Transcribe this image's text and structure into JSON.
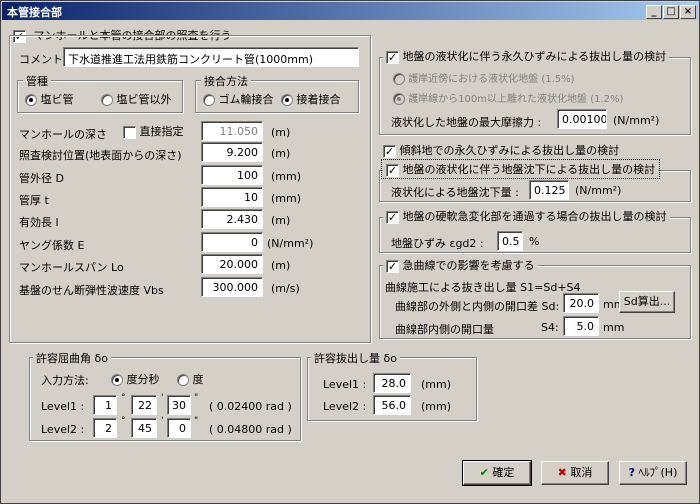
{
  "window": {
    "title": "本管接合部"
  },
  "main_check": {
    "label": "マンホールと本管の接合部の照査を行う",
    "checked": true
  },
  "comment": {
    "label": "コメント:",
    "value": "下水道推進工法用鉄筋コンクリート管(1000mm)"
  },
  "pipe_type": {
    "title": "管種",
    "options": [
      "塩ビ管",
      "塩ビ管以外"
    ],
    "selected": 0
  },
  "joint_method": {
    "title": "接合方法",
    "options": [
      "ゴム輪接合",
      "接着接合"
    ],
    "selected": 1
  },
  "fields": {
    "manhole_depth": {
      "label": "マンホールの深さ",
      "direct_label": "直接指定",
      "value": "11.050",
      "unit": "(m)"
    },
    "check_position": {
      "label": "照査検討位置(地表面からの深さ)",
      "value": "9.200",
      "unit": "(m)"
    },
    "outer_diameter": {
      "label": "管外径 D",
      "value": "100",
      "unit": "(mm)"
    },
    "thickness": {
      "label": "管厚 t",
      "value": "10",
      "unit": "(mm)"
    },
    "effective_length": {
      "label": "有効長 l",
      "value": "2.430",
      "unit": "(m)"
    },
    "young_modulus": {
      "label": "ヤング係数 E",
      "value": "0",
      "unit": "(N/mm²)"
    },
    "manhole_span": {
      "label": "マンホールスパン Lo",
      "value": "20.000",
      "unit": "(m)"
    },
    "shear_wave": {
      "label": "基盤のせん断弾性波速度 Vbs",
      "value": "300.000",
      "unit": "(m/s)"
    }
  },
  "liquefaction": {
    "label": "地盤の液状化に伴う永久ひずみによる抜出し量の検討",
    "checked": true,
    "options": [
      "護岸近傍における液状化地盤 (1.5%)",
      "護岸線から100m以上離れた液状化地盤 (1.2%)"
    ],
    "selected": 1,
    "friction_label": "液状化した地盤の最大摩擦力 :",
    "friction_value": "0.00100",
    "friction_unit": "(N/mm²)"
  },
  "slope": {
    "label": "傾斜地での永久ひずみによる抜出し量の検討",
    "checked": true
  },
  "settlement": {
    "label": "地盤の液状化に伴う地盤沈下による抜出し量の検討",
    "checked": true,
    "value_label": "液状化による地盤沈下量 :",
    "value": "0.125",
    "unit": "(N/mm²)"
  },
  "hardness": {
    "label": "地盤の硬軟急変化部を通過する場合の抜出し量の検討",
    "checked": true,
    "value_label": "地盤ひずみ εgd2 :",
    "value": "0.5",
    "unit": "%"
  },
  "curve": {
    "label": "急曲線での影響を考慮する",
    "checked": true,
    "formula": "曲線施工による抜き出し量 S1=Sd+S4",
    "sd_label": "曲線部の外側と内側の開口差 Sd:",
    "sd_value": "20.0",
    "sd_unit": "mm",
    "sd_button": "Sd算出...",
    "s4_label": "曲線部内側の開口量",
    "s4_short": "S4:",
    "s4_value": "5.0",
    "s4_unit": "mm"
  },
  "allow_angle": {
    "title": "許容屈曲角 δo",
    "input_label": "入力方法:",
    "options": [
      "度分秒",
      "度"
    ],
    "selected": 0,
    "level1": {
      "label": "Level1 :",
      "deg": "1",
      "min": "22",
      "sec": "30",
      "rad": "( 0.02400 rad )"
    },
    "level2": {
      "label": "Level2 :",
      "deg": "2",
      "min": "45",
      "sec": "0",
      "rad": "( 0.04800 rad )"
    }
  },
  "allow_pull": {
    "title": "許容抜出し量 δo",
    "level1": {
      "label": "Level1 :",
      "value": "28.0",
      "unit": "(mm)"
    },
    "level2": {
      "label": "Level2 :",
      "value": "56.0",
      "unit": "(mm)"
    }
  },
  "buttons": {
    "ok": "確定",
    "cancel": "取消",
    "help": "ﾍﾙﾌﾟ(H)"
  },
  "colors": {
    "title_start": "#0a246a",
    "title_end": "#a6caf0",
    "face": "#d4d0c8"
  }
}
